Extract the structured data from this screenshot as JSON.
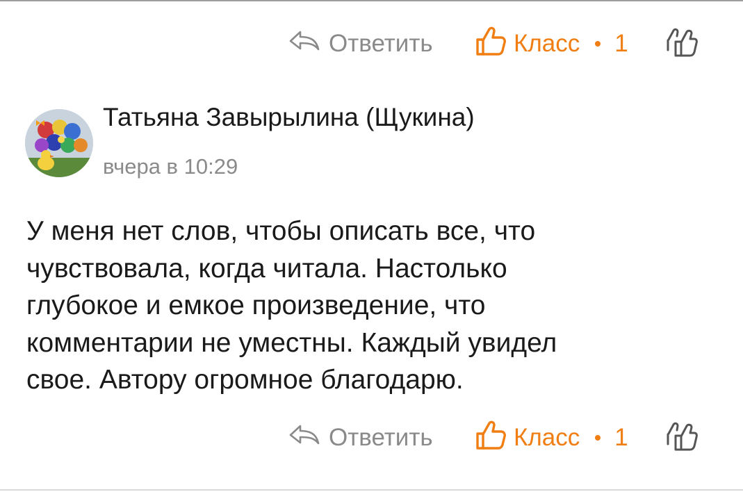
{
  "colors": {
    "accent": "#f07e12",
    "muted": "#8a8a8a",
    "text": "#1a1a1a"
  },
  "actions": {
    "reply_label": "Ответить",
    "klass_label": "Класс",
    "klass_count": "1",
    "reply_icon": "reply-arrow-icon",
    "klass_icon": "thumbs-up-icon",
    "likers_icon": "double-thumbs-up-icon"
  },
  "comment": {
    "author": "Татьяна Завырылина (Щукина)",
    "time": "вчера в 10:29",
    "avatar_icon": "balloons-avatar",
    "lines": [
      "У меня нет слов, чтобы описать все, что",
      "чувствовала, когда читала. Настолько",
      "глубокое и емкое произведение, что",
      "комментарии не уместны. Каждый увидел",
      "свое. Автору огромное благодарю."
    ]
  },
  "actions_bottom": {
    "reply_label": "Ответить",
    "klass_label": "Класс",
    "klass_count": "1"
  }
}
